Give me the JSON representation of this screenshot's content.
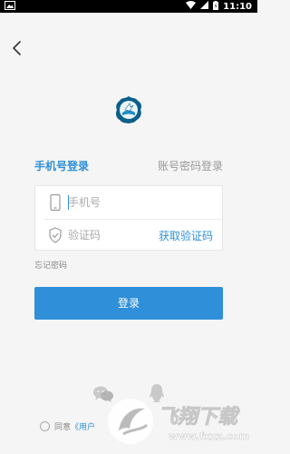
{
  "status_bar": {
    "time": "11:10"
  },
  "tabs": {
    "phone_login": "手机号登录",
    "account_login": "账号密码登录"
  },
  "form": {
    "phone_placeholder": "手机号",
    "code_placeholder": "验证码",
    "get_code_label": "获取验证码"
  },
  "forgot_password_label": "忘记密码",
  "login_button_label": "登录",
  "agreement": {
    "prefix": "同意",
    "link": "《用户"
  },
  "watermark": {
    "title": "飞翔下载",
    "url": "www.fxxz.com"
  },
  "colors": {
    "accent": "#2f8fd8",
    "background": "#f5f5f5"
  }
}
